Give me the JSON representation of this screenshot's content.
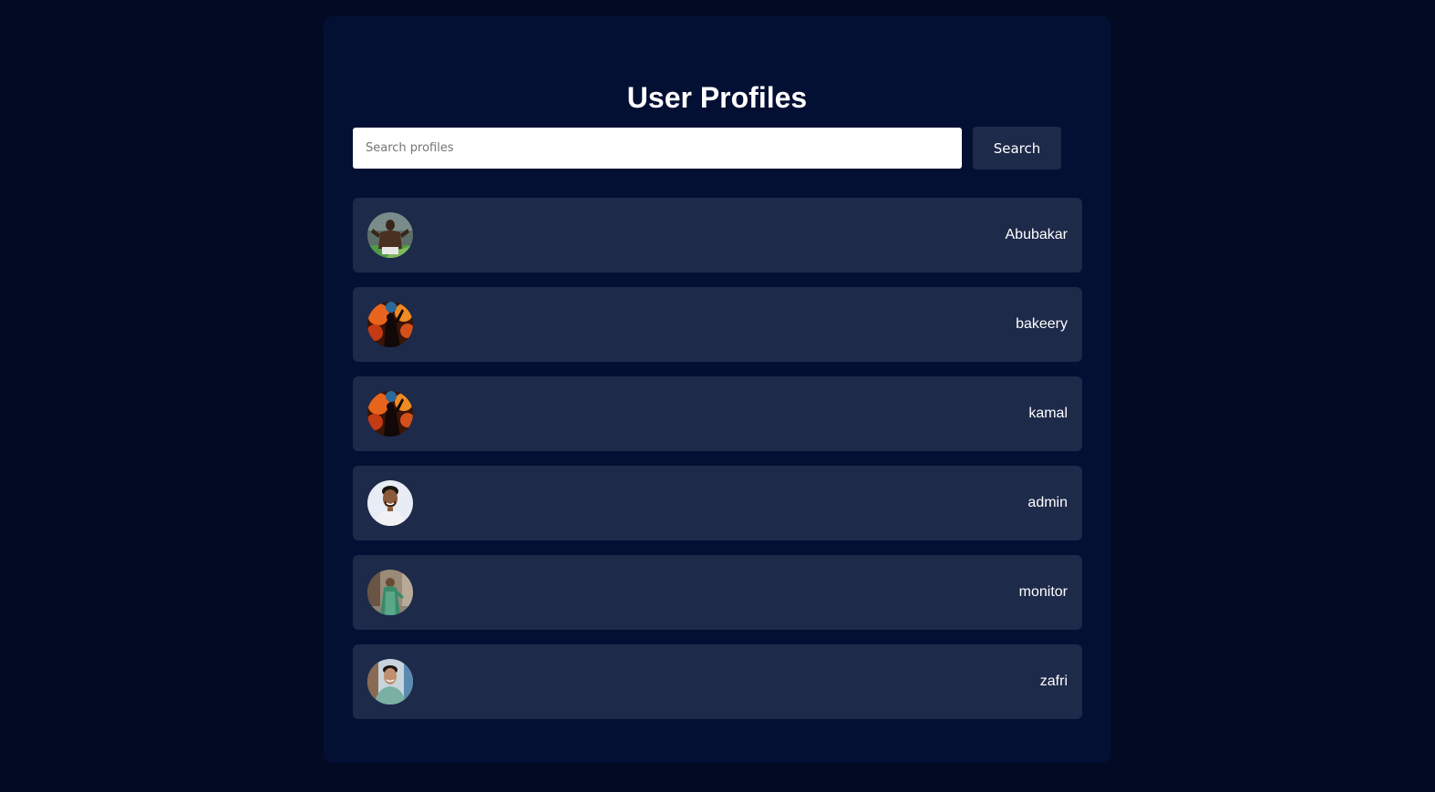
{
  "page": {
    "title": "User Profiles"
  },
  "search": {
    "placeholder": "Search profiles",
    "value": "",
    "button_label": "Search"
  },
  "profiles": [
    {
      "username": "Abubakar",
      "avatar": "footballer-photo"
    },
    {
      "username": "bakeery",
      "avatar": "fire-silhouette-photo"
    },
    {
      "username": "kamal",
      "avatar": "fire-silhouette-photo"
    },
    {
      "username": "admin",
      "avatar": "smiling-man-photo"
    },
    {
      "username": "monitor",
      "avatar": "woman-green-dress-photo"
    },
    {
      "username": "zafri",
      "avatar": "man-outdoor-photo"
    }
  ],
  "colors": {
    "background": "#030b24",
    "panel": "#041033",
    "card": "#1e2a4a",
    "text": "#ffffff"
  }
}
